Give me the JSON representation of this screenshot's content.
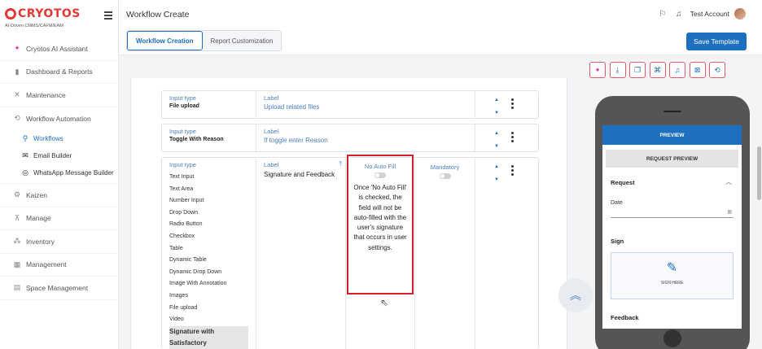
{
  "brand": {
    "name": "CRYOTOS",
    "tagline": "AI-Driven CMMS/CAFM/EAM"
  },
  "sidebar": {
    "items": [
      {
        "label": "Cryotos AI Assistant",
        "icon": "sparkle-icon"
      },
      {
        "label": "Dashboard & Reports",
        "icon": "bar-chart-icon"
      },
      {
        "label": "Maintenance",
        "icon": "tools-icon"
      },
      {
        "label": "Workflow Automation",
        "icon": "workflow-icon"
      },
      {
        "label": "Kaizen",
        "icon": "gear-icon"
      },
      {
        "label": "Manage",
        "icon": "cart-icon"
      },
      {
        "label": "Inventory",
        "icon": "inventory-icon"
      },
      {
        "label": "Management",
        "icon": "management-icon"
      },
      {
        "label": "Space Management",
        "icon": "building-icon"
      }
    ],
    "sub_items": [
      {
        "label": "Workflows",
        "icon": "flow-icon"
      },
      {
        "label": "Email Builder",
        "icon": "mail-icon"
      },
      {
        "label": "WhatsApp Message Builder",
        "icon": "whatsapp-icon"
      }
    ]
  },
  "header": {
    "title": "Workflow Create",
    "user": "Test Account",
    "tabs": [
      "Workflow Creation",
      "Report Customization"
    ],
    "save_label": "Save Template"
  },
  "fields": [
    {
      "type_label": "Input type",
      "type_value": "File upload",
      "label_caption": "Label",
      "label_value": "Upload related files"
    },
    {
      "type_label": "Input type",
      "type_value": "Toggle With Reason",
      "label_caption": "Label",
      "label_value": "If toggle enter Reason"
    },
    {
      "type_label": "Input type",
      "label_caption": "Label",
      "label_value": "Signature and Feedback",
      "type_options": [
        "Text Input",
        "Text Area",
        "Number Input",
        "Drop Down",
        "Radio Button",
        "Checkbox",
        "Table",
        "Dynamic Table",
        "Dynamic Drop Down",
        "Image With Annotation",
        "Images",
        "File upload",
        "Video"
      ],
      "selected_option": "Signature with Satisfactory",
      "no_auto_fill": "No Auto Fill",
      "no_auto_fill_note": "Once 'No Auto Fill' is checked, the field will not be auto-filled with the user's signature that occurs in user settings.",
      "mandatory": "Mandatory"
    }
  ],
  "preview": {
    "header": "PREVIEW",
    "request_preview": "REQUEST PREVIEW",
    "request_title": "Request",
    "date_label": "Date",
    "sign_title": "Sign",
    "sign_here": "SIGN HERE",
    "feedback_title": "Feedback"
  }
}
